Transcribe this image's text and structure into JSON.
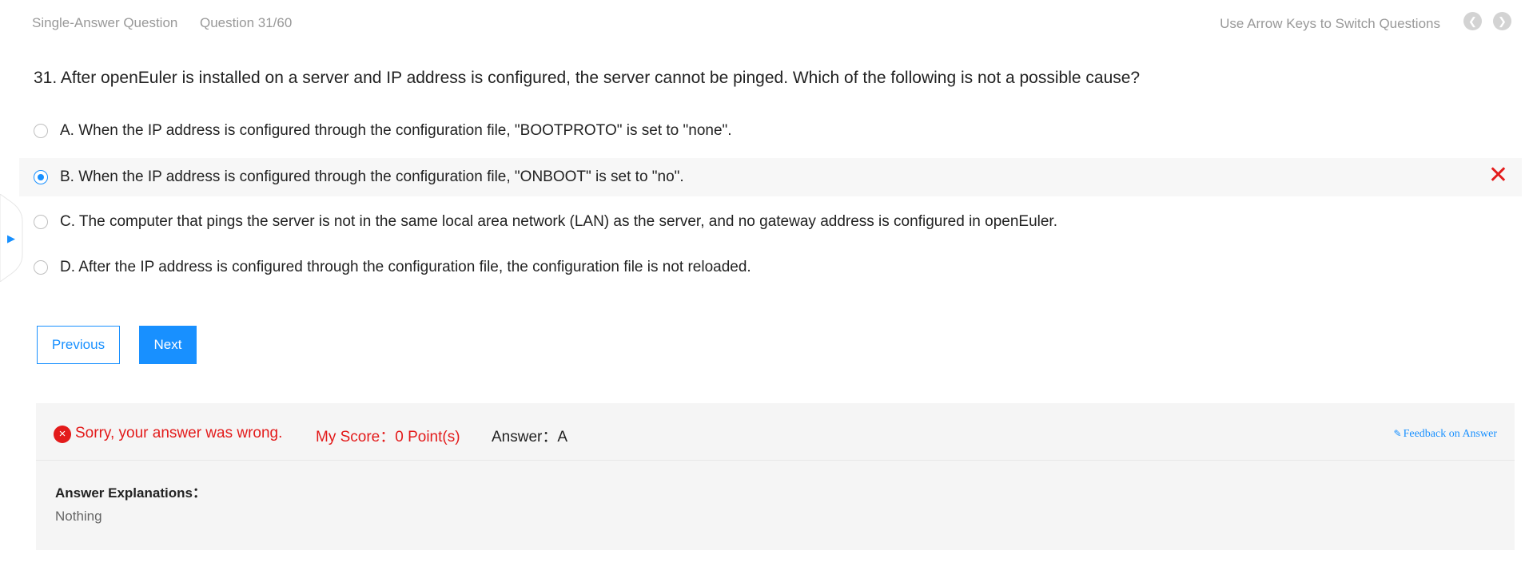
{
  "header": {
    "question_type": "Single-Answer Question",
    "question_progress": "Question 31/60",
    "hint": "Use Arrow Keys to Switch Questions"
  },
  "question": {
    "text": "31. After openEuler is installed on a server and IP address is configured, the server cannot be pinged. Which of the following is not a possible cause?",
    "options": [
      {
        "label": "A. When the IP address is configured through the configuration file, \"BOOTPROTO\" is set to \"none\".",
        "selected": false
      },
      {
        "label": "B. When the IP address is configured through the configuration file, \"ONBOOT\" is set to \"no\".",
        "selected": true,
        "marked_wrong": true
      },
      {
        "label": "C. The computer that pings the server is not in the same local area network (LAN) as the server, and no gateway address is configured in openEuler.",
        "selected": false
      },
      {
        "label": "D. After the IP address is configured through the configuration file, the configuration file is not reloaded.",
        "selected": false
      }
    ]
  },
  "buttons": {
    "previous": "Previous",
    "next": "Next"
  },
  "result": {
    "status": "Sorry, your answer was wrong.",
    "score": "My Score：0 Point(s)",
    "answer": "Answer：A",
    "feedback_link": "Feedback on Answer",
    "explanation_title": "Answer Explanations：",
    "explanation_text": "Nothing"
  },
  "colors": {
    "accent": "#1890ff",
    "error": "#e31b1b",
    "muted_text": "#999999",
    "panel_bg": "#f5f5f5"
  }
}
